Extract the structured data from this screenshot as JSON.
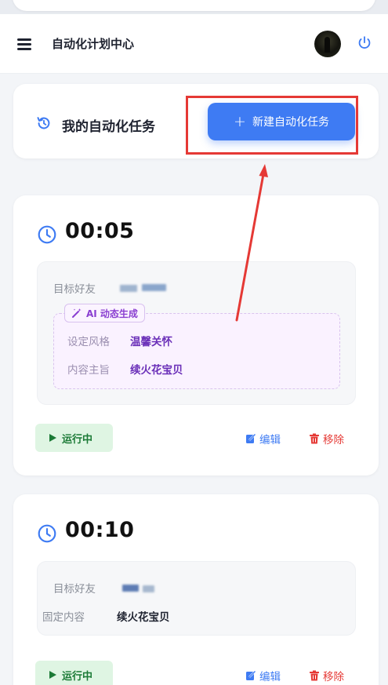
{
  "header": {
    "title": "自动化计划中心"
  },
  "section": {
    "title": "我的自动化任务",
    "new_task_label": "新建自动化任务"
  },
  "tasks": [
    {
      "time": "00:05",
      "target_label": "目标好友",
      "ai_badge": "AI 动态生成",
      "style_label": "设定风格",
      "style_value": "温馨关怀",
      "theme_label": "内容主旨",
      "theme_value": "续火花宝贝",
      "status": "运行中",
      "edit_label": "编辑",
      "remove_label": "移除"
    },
    {
      "time": "00:10",
      "target_label": "目标好友",
      "content_label": "固定内容",
      "content_value": "续火花宝贝",
      "status": "运行中",
      "edit_label": "编辑",
      "remove_label": "移除"
    }
  ],
  "colors": {
    "accent": "#3e7bf3",
    "annotation": "#e53935",
    "running_bg": "#dff5e3",
    "running_text": "#1b7a36",
    "ai_text": "#8a3fd1"
  },
  "icons": [
    "menu-icon",
    "power-icon",
    "history-icon",
    "plus-icon",
    "clock-icon",
    "magic-wand-icon",
    "play-icon",
    "edit-icon",
    "trash-icon"
  ]
}
